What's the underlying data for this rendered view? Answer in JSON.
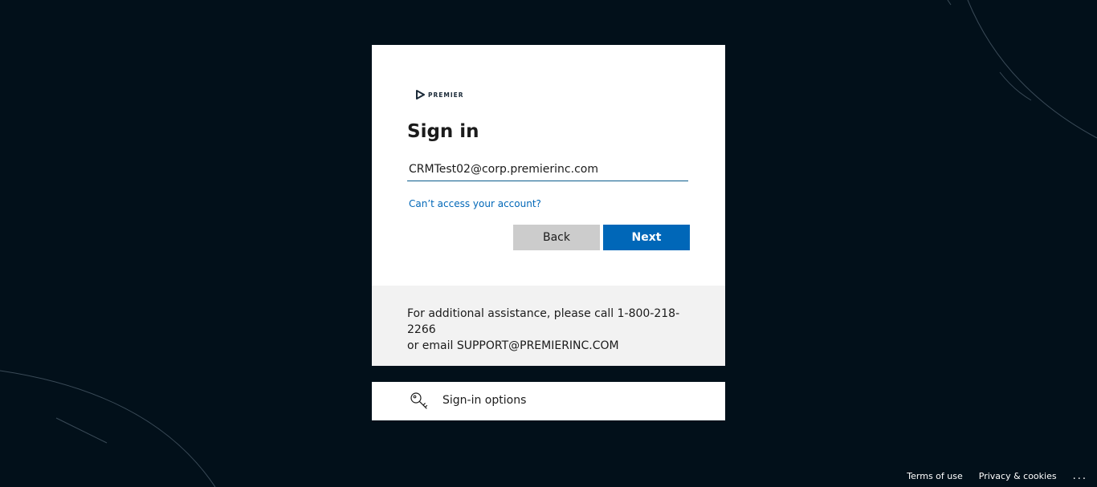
{
  "brand": {
    "logo_text": "PREMIER",
    "logo_color": "#1b2a38"
  },
  "signin": {
    "title": "Sign in",
    "email_value": "CRMTest02@corp.premierinc.com",
    "cant_access_link": "Can’t access your account?",
    "back_label": "Back",
    "next_label": "Next",
    "accent_color": "#0067b8"
  },
  "assistance": {
    "line1": "For additional assistance, please call 1-800-218-2266",
    "line2": "or email SUPPORT@PREMIERINC.COM"
  },
  "options": {
    "icon": "key-icon",
    "label": "Sign-in options"
  },
  "footer": {
    "terms": "Terms of use",
    "privacy": "Privacy & cookies",
    "more": "..."
  }
}
